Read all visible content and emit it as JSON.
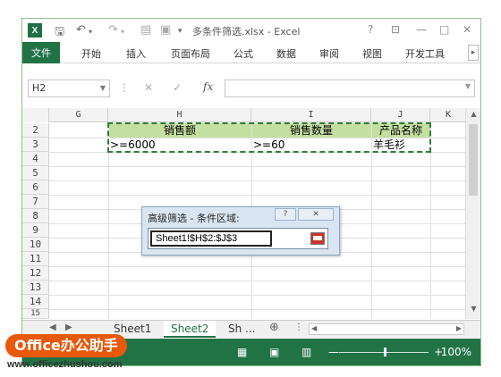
{
  "titlebar": {
    "title": "多条件筛选.xlsx - Excel",
    "logo": "X",
    "help": "?",
    "ribbon_display": "⊡",
    "minimize": "—",
    "maximize": "□",
    "close": "✕"
  },
  "ribbon": {
    "file": "文件",
    "tabs": [
      "开始",
      "插入",
      "页面布局",
      "公式",
      "数据",
      "审阅",
      "视图",
      "开发工具"
    ],
    "more": "▸"
  },
  "formula_bar": {
    "name_box": "H2",
    "cancel": "✕",
    "enter": "✓",
    "fx": "fx",
    "value": ""
  },
  "grid": {
    "columns": [
      "G",
      "H",
      "I",
      "J",
      "K"
    ],
    "rows": [
      "2",
      "3",
      "4",
      "5",
      "6",
      "7",
      "8",
      "9",
      "10",
      "11",
      "12",
      "13",
      "14",
      "15"
    ],
    "header_row": [
      "销售额",
      "销售数量",
      "产品名称"
    ],
    "criteria_row": [
      ">=6000",
      ">=60",
      "羊毛衫"
    ],
    "header_fill": "#c4dfa0"
  },
  "dialog": {
    "title": "高级筛选 - 条件区域:",
    "help": "?",
    "close": "✕",
    "value": "Sheet1!$H$2:$J$3"
  },
  "sheets": {
    "tabs": [
      "Sheet1",
      "Sheet2",
      "Sh ..."
    ],
    "active": "Sheet2",
    "add": "⊕"
  },
  "status": {
    "zoom": "100%",
    "zoom_out": "—",
    "zoom_in": "+"
  },
  "watermark": {
    "brand": "Office办公助手",
    "url": "www.officezhushou.com"
  },
  "colors": {
    "excel_green": "#217346",
    "criteria_header": "#c4dfa0",
    "watermark_orange": "#e8590c"
  }
}
